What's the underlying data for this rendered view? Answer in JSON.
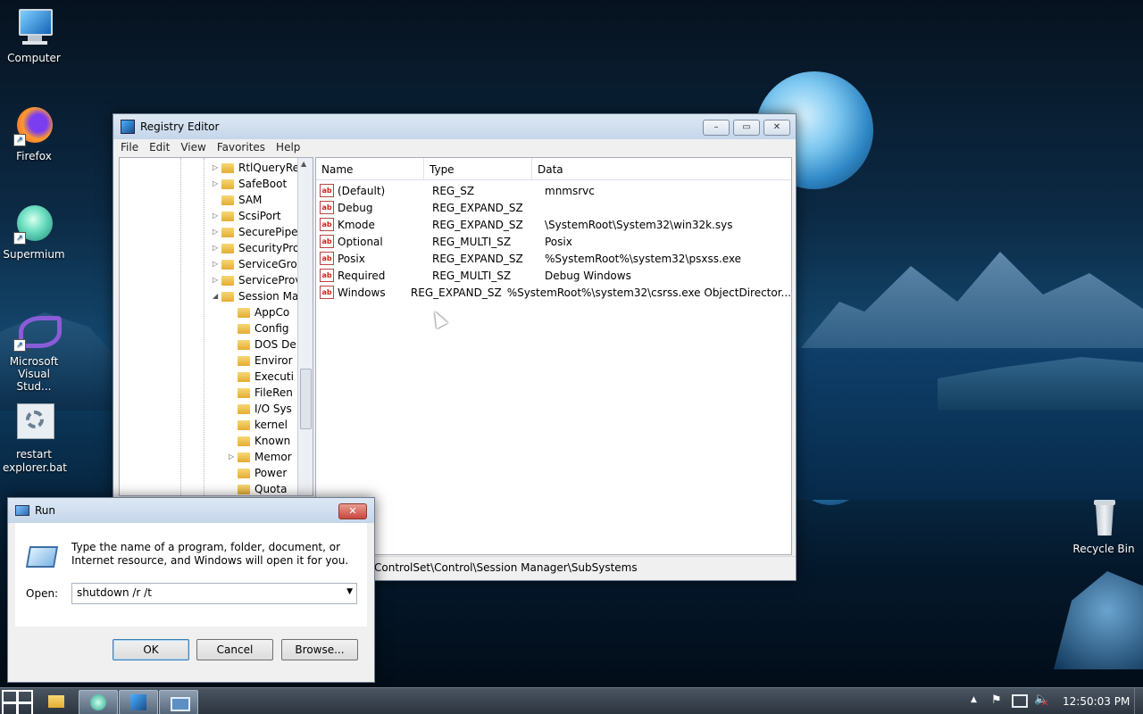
{
  "desktop": {
    "icons": [
      {
        "label": "Computer",
        "icon": "computer-icon"
      },
      {
        "label": "Firefox",
        "icon": "firefox-icon"
      },
      {
        "label": "Supermium",
        "icon": "supermium-icon"
      },
      {
        "label": "Microsoft Visual Stud...",
        "icon": "visual-studio-icon"
      },
      {
        "label": "restart explorer.bat",
        "icon": "bat-file-icon"
      },
      {
        "label": "Recycle Bin",
        "icon": "recycle-bin-icon"
      }
    ]
  },
  "regedit": {
    "title": "Registry Editor",
    "menu": [
      "File",
      "Edit",
      "View",
      "Favorites",
      "Help"
    ],
    "tree": [
      {
        "label": "RtlQueryRe",
        "expander": "▷",
        "level": 0
      },
      {
        "label": "SafeBoot",
        "expander": "▷",
        "level": 0
      },
      {
        "label": "SAM",
        "expander": "",
        "level": 0
      },
      {
        "label": "ScsiPort",
        "expander": "▷",
        "level": 0
      },
      {
        "label": "SecurePipe",
        "expander": "▷",
        "level": 0
      },
      {
        "label": "SecurityPro",
        "expander": "▷",
        "level": 0
      },
      {
        "label": "ServiceGro",
        "expander": "▷",
        "level": 0
      },
      {
        "label": "ServiceProv",
        "expander": "▷",
        "level": 0
      },
      {
        "label": "Session Ma",
        "expander": "◢",
        "level": 0
      },
      {
        "label": "AppCo",
        "expander": "",
        "level": 1
      },
      {
        "label": "Config",
        "expander": "",
        "level": 1
      },
      {
        "label": "DOS De",
        "expander": "",
        "level": 1
      },
      {
        "label": "Enviror",
        "expander": "",
        "level": 1
      },
      {
        "label": "Executi",
        "expander": "",
        "level": 1
      },
      {
        "label": "FileRen",
        "expander": "",
        "level": 1
      },
      {
        "label": "I/O Sys",
        "expander": "",
        "level": 1
      },
      {
        "label": "kernel",
        "expander": "",
        "level": 1
      },
      {
        "label": "Known",
        "expander": "",
        "level": 1
      },
      {
        "label": "Memor",
        "expander": "▷",
        "level": 1
      },
      {
        "label": "Power",
        "expander": "",
        "level": 1
      },
      {
        "label": "Quota",
        "expander": "",
        "level": 1
      }
    ],
    "columns": [
      "Name",
      "Type",
      "Data"
    ],
    "values": [
      {
        "name": "(Default)",
        "type": "REG_SZ",
        "data": "mnmsrvc"
      },
      {
        "name": "Debug",
        "type": "REG_EXPAND_SZ",
        "data": ""
      },
      {
        "name": "Kmode",
        "type": "REG_EXPAND_SZ",
        "data": "\\SystemRoot\\System32\\win32k.sys"
      },
      {
        "name": "Optional",
        "type": "REG_MULTI_SZ",
        "data": "Posix"
      },
      {
        "name": "Posix",
        "type": "REG_EXPAND_SZ",
        "data": "%SystemRoot%\\system32\\psxss.exe"
      },
      {
        "name": "Required",
        "type": "REG_MULTI_SZ",
        "data": "Debug Windows"
      },
      {
        "name": "Windows",
        "type": "REG_EXPAND_SZ",
        "data": "%SystemRoot%\\system32\\csrss.exe ObjectDirector..."
      }
    ],
    "status": "ControlSet\\Control\\Session Manager\\SubSystems"
  },
  "run": {
    "title": "Run",
    "description": "Type the name of a program, folder, document, or Internet resource, and Windows will open it for you.",
    "open_label": "Open:",
    "open_value": "shutdown /r /t",
    "ok": "OK",
    "cancel": "Cancel",
    "browse": "Browse..."
  },
  "taskbar": {
    "clock": "12:50:03 PM",
    "items": [
      "start-icon",
      "file-explorer-icon",
      "supermium-icon",
      "regedit-icon",
      "run-icon"
    ]
  },
  "colors": {
    "accent": "#2b343e",
    "close_button": "#c9463d"
  }
}
